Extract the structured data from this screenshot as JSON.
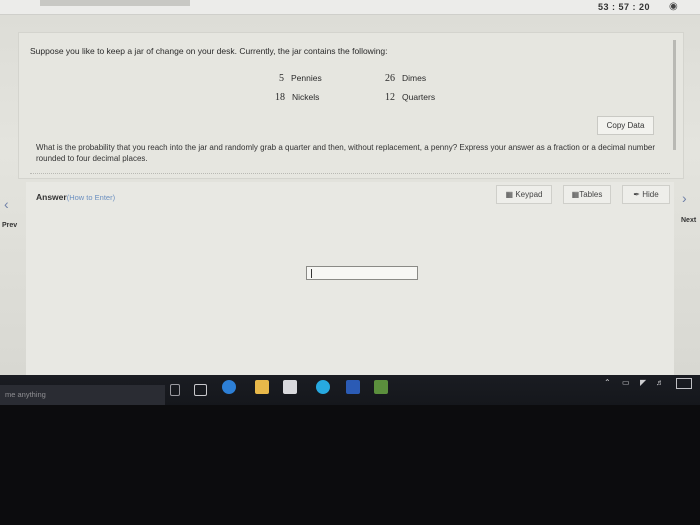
{
  "header": {
    "timer": "53 : 57 : 20",
    "timer_icon": "eye-icon"
  },
  "question": {
    "intro": "Suppose you like to keep a jar of change on your desk. Currently, the jar contains the following:",
    "coins": [
      {
        "count": "5",
        "name": "Pennies"
      },
      {
        "count": "26",
        "name": "Dimes"
      },
      {
        "count": "18",
        "name": "Nickels"
      },
      {
        "count": "12",
        "name": "Quarters"
      }
    ],
    "copy_button": "Copy Data",
    "prompt": "What is the probability that you reach into the jar and randomly grab a quarter and then, without replacement, a penny? Express your answer as a fraction or a decimal number rounded to four decimal places."
  },
  "answer": {
    "title": "Answer",
    "help_link": "(How to Enter)",
    "keypad_label": "Keypad",
    "tables_label": "Tables",
    "hide_label": "Hide",
    "value": ""
  },
  "nav": {
    "prev_label": "Prev",
    "next_label": "Next"
  },
  "taskbar": {
    "search_placeholder": "me anything"
  },
  "colors": {
    "page_bg": "#e4e4de",
    "accent_link": "#6b8fc0",
    "taskbar_bg": "#16181d"
  }
}
